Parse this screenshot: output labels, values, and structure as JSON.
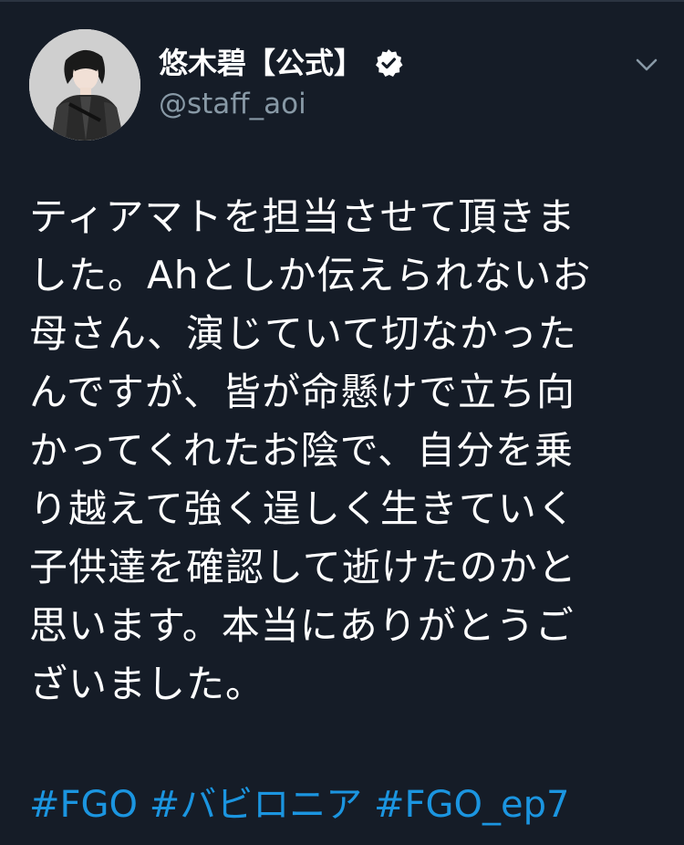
{
  "author": {
    "display_name": "悠木碧【公式】",
    "handle": "@staff_aoi",
    "verified": true
  },
  "icons": {
    "avatar": "avatar-photo",
    "verified": "verified-badge-icon",
    "menu": "chevron-down-icon"
  },
  "tweet": {
    "lines": [
      "ティアマトを担当させて頂きま",
      "した。Ahとしか伝えられないお",
      "母さん、演じていて切なかった",
      "んですが、皆が命懸けで立ち向",
      "かってくれたお陰で、自分を乗",
      "り越えて強く逞しく生きていく",
      "子供達を確認して逝けたのかと",
      "思います。本当にありがとうご",
      "ざいました。"
    ],
    "hashtags": [
      "#FGO",
      "#バビロニア",
      "#FGO_ep7"
    ]
  },
  "colors": {
    "background": "#151c27",
    "text": "#ffffff",
    "secondary": "#8899a6",
    "link": "#1b95e0"
  }
}
